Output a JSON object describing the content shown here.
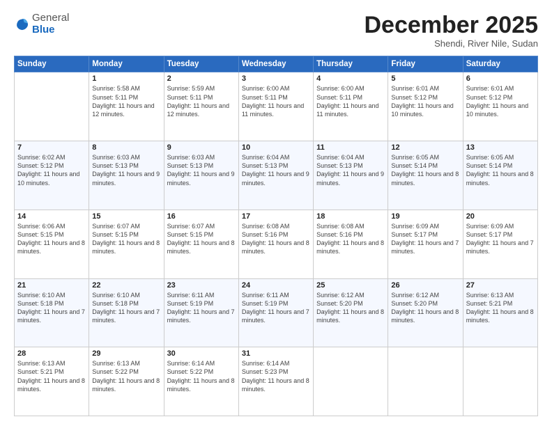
{
  "header": {
    "logo_general": "General",
    "logo_blue": "Blue",
    "month": "December 2025",
    "location": "Shendi, River Nile, Sudan"
  },
  "days_of_week": [
    "Sunday",
    "Monday",
    "Tuesday",
    "Wednesday",
    "Thursday",
    "Friday",
    "Saturday"
  ],
  "weeks": [
    [
      {
        "day": "",
        "info": ""
      },
      {
        "day": "1",
        "info": "Sunrise: 5:58 AM\nSunset: 5:11 PM\nDaylight: 11 hours and 12 minutes."
      },
      {
        "day": "2",
        "info": "Sunrise: 5:59 AM\nSunset: 5:11 PM\nDaylight: 11 hours and 12 minutes."
      },
      {
        "day": "3",
        "info": "Sunrise: 6:00 AM\nSunset: 5:11 PM\nDaylight: 11 hours and 11 minutes."
      },
      {
        "day": "4",
        "info": "Sunrise: 6:00 AM\nSunset: 5:11 PM\nDaylight: 11 hours and 11 minutes."
      },
      {
        "day": "5",
        "info": "Sunrise: 6:01 AM\nSunset: 5:12 PM\nDaylight: 11 hours and 10 minutes."
      },
      {
        "day": "6",
        "info": "Sunrise: 6:01 AM\nSunset: 5:12 PM\nDaylight: 11 hours and 10 minutes."
      }
    ],
    [
      {
        "day": "7",
        "info": "Sunrise: 6:02 AM\nSunset: 5:12 PM\nDaylight: 11 hours and 10 minutes."
      },
      {
        "day": "8",
        "info": "Sunrise: 6:03 AM\nSunset: 5:13 PM\nDaylight: 11 hours and 9 minutes."
      },
      {
        "day": "9",
        "info": "Sunrise: 6:03 AM\nSunset: 5:13 PM\nDaylight: 11 hours and 9 minutes."
      },
      {
        "day": "10",
        "info": "Sunrise: 6:04 AM\nSunset: 5:13 PM\nDaylight: 11 hours and 9 minutes."
      },
      {
        "day": "11",
        "info": "Sunrise: 6:04 AM\nSunset: 5:13 PM\nDaylight: 11 hours and 9 minutes."
      },
      {
        "day": "12",
        "info": "Sunrise: 6:05 AM\nSunset: 5:14 PM\nDaylight: 11 hours and 8 minutes."
      },
      {
        "day": "13",
        "info": "Sunrise: 6:05 AM\nSunset: 5:14 PM\nDaylight: 11 hours and 8 minutes."
      }
    ],
    [
      {
        "day": "14",
        "info": "Sunrise: 6:06 AM\nSunset: 5:15 PM\nDaylight: 11 hours and 8 minutes."
      },
      {
        "day": "15",
        "info": "Sunrise: 6:07 AM\nSunset: 5:15 PM\nDaylight: 11 hours and 8 minutes."
      },
      {
        "day": "16",
        "info": "Sunrise: 6:07 AM\nSunset: 5:15 PM\nDaylight: 11 hours and 8 minutes."
      },
      {
        "day": "17",
        "info": "Sunrise: 6:08 AM\nSunset: 5:16 PM\nDaylight: 11 hours and 8 minutes."
      },
      {
        "day": "18",
        "info": "Sunrise: 6:08 AM\nSunset: 5:16 PM\nDaylight: 11 hours and 8 minutes."
      },
      {
        "day": "19",
        "info": "Sunrise: 6:09 AM\nSunset: 5:17 PM\nDaylight: 11 hours and 7 minutes."
      },
      {
        "day": "20",
        "info": "Sunrise: 6:09 AM\nSunset: 5:17 PM\nDaylight: 11 hours and 7 minutes."
      }
    ],
    [
      {
        "day": "21",
        "info": "Sunrise: 6:10 AM\nSunset: 5:18 PM\nDaylight: 11 hours and 7 minutes."
      },
      {
        "day": "22",
        "info": "Sunrise: 6:10 AM\nSunset: 5:18 PM\nDaylight: 11 hours and 7 minutes."
      },
      {
        "day": "23",
        "info": "Sunrise: 6:11 AM\nSunset: 5:19 PM\nDaylight: 11 hours and 7 minutes."
      },
      {
        "day": "24",
        "info": "Sunrise: 6:11 AM\nSunset: 5:19 PM\nDaylight: 11 hours and 7 minutes."
      },
      {
        "day": "25",
        "info": "Sunrise: 6:12 AM\nSunset: 5:20 PM\nDaylight: 11 hours and 8 minutes."
      },
      {
        "day": "26",
        "info": "Sunrise: 6:12 AM\nSunset: 5:20 PM\nDaylight: 11 hours and 8 minutes."
      },
      {
        "day": "27",
        "info": "Sunrise: 6:13 AM\nSunset: 5:21 PM\nDaylight: 11 hours and 8 minutes."
      }
    ],
    [
      {
        "day": "28",
        "info": "Sunrise: 6:13 AM\nSunset: 5:21 PM\nDaylight: 11 hours and 8 minutes."
      },
      {
        "day": "29",
        "info": "Sunrise: 6:13 AM\nSunset: 5:22 PM\nDaylight: 11 hours and 8 minutes."
      },
      {
        "day": "30",
        "info": "Sunrise: 6:14 AM\nSunset: 5:22 PM\nDaylight: 11 hours and 8 minutes."
      },
      {
        "day": "31",
        "info": "Sunrise: 6:14 AM\nSunset: 5:23 PM\nDaylight: 11 hours and 8 minutes."
      },
      {
        "day": "",
        "info": ""
      },
      {
        "day": "",
        "info": ""
      },
      {
        "day": "",
        "info": ""
      }
    ]
  ]
}
